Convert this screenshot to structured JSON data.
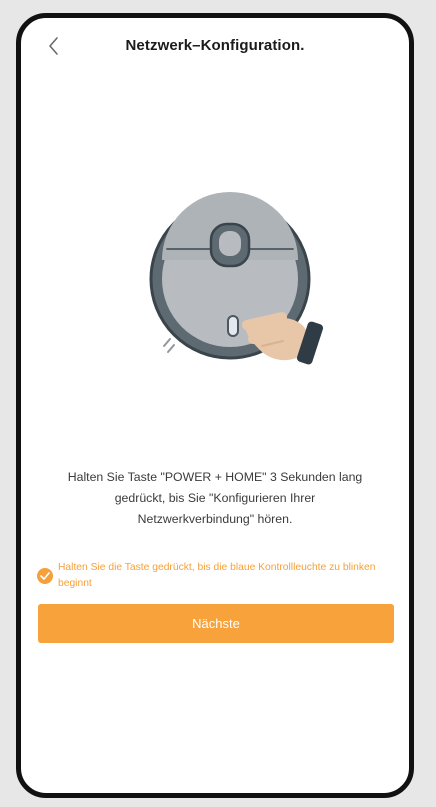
{
  "header": {
    "title": "Netzwerk–Konfiguration.",
    "back_icon": "chevron-left-icon"
  },
  "illustration": {
    "name": "robot-vacuum-with-hand",
    "colors": {
      "body": "#5e6a72",
      "top": "#b8bcc0",
      "hand": "#e8c6a8",
      "sleeve": "#2f3c45"
    }
  },
  "content": {
    "instruction_line1": "Halten Sie Taste \"POWER + HOME\" 3 Sekunden lang",
    "instruction_line2": "gedrückt, bis Sie \"Konfigurieren Ihrer",
    "instruction_line3": "Netzwerkverbindung\" hören.",
    "hint_text": "Halten Sie die Taste gedrückt, bis die blaue Kontrollleuchte zu blinken beginnt",
    "hint_checked": true
  },
  "actions": {
    "next_label": "Nächste"
  },
  "colors": {
    "accent": "#f7a23a",
    "text": "#3b3b3b",
    "title": "#1b1b1b",
    "background": "#ffffff"
  }
}
